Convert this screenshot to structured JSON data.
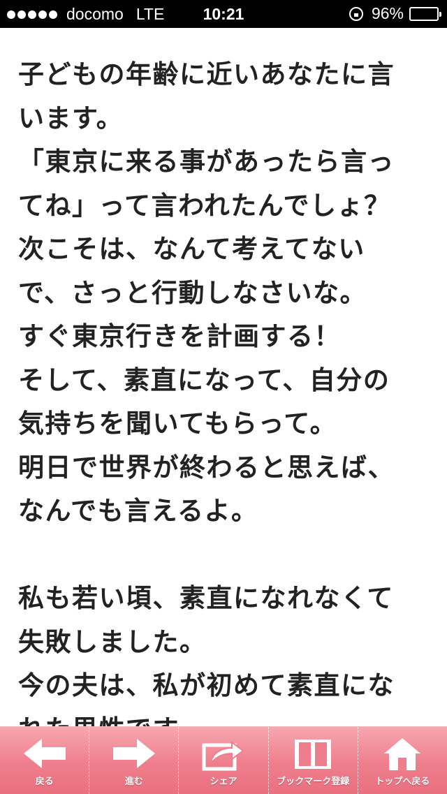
{
  "status_bar": {
    "carrier": "docomo",
    "network": "LTE",
    "time": "10:21",
    "battery_percent": "96%"
  },
  "article": {
    "lines": [
      "子どもの年齢に近いあなたに言",
      "います。",
      "「東京に来る事があったら言っ",
      "てね」って言われたんでしょ？",
      "次こそは、なんて考えてない",
      "で、さっと行動しなさいな。",
      "すぐ東京行きを計画する！",
      "そして、素直になって、自分の",
      "気持ちを聞いてもらって。",
      "明日で世界が終わると思えば、",
      "なんでも言えるよ。",
      "",
      "私も若い頃、素直になれなくて",
      "失敗しました。",
      "今の夫は、私が初めて素直にな",
      "れた男性です。"
    ]
  },
  "toolbar": {
    "back_label": "戻る",
    "forward_label": "進む",
    "share_label": "シェア",
    "bookmark_label": "ブックマーク登録",
    "top_label": "トップへ戻る",
    "icons": [
      "arrow-left-icon",
      "arrow-right-icon",
      "share-icon",
      "book-icon",
      "home-icon"
    ],
    "colors": {
      "bar": "#ef7e8c",
      "icon": "#ffffff"
    }
  }
}
